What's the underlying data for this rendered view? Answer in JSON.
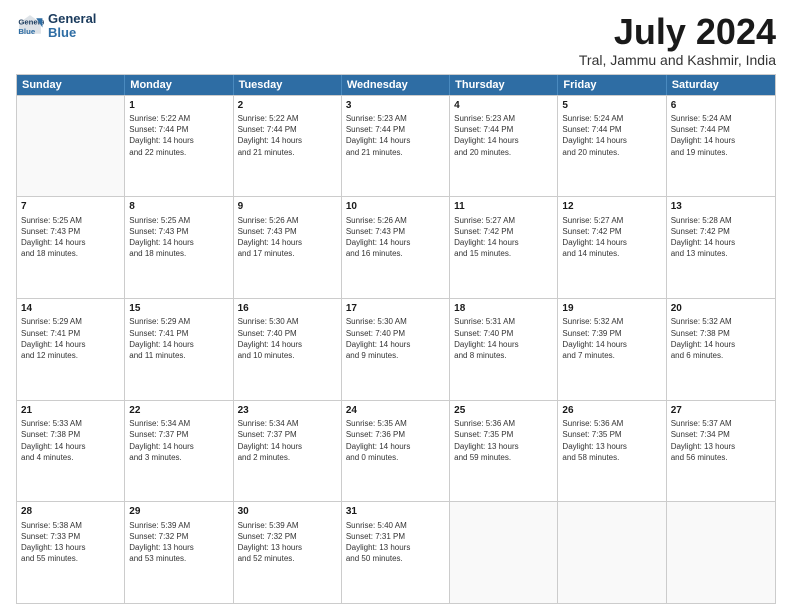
{
  "logo": {
    "line1": "General",
    "line2": "Blue"
  },
  "title": "July 2024",
  "subtitle": "Tral, Jammu and Kashmir, India",
  "weekdays": [
    "Sunday",
    "Monday",
    "Tuesday",
    "Wednesday",
    "Thursday",
    "Friday",
    "Saturday"
  ],
  "rows": [
    [
      {
        "day": "",
        "info": ""
      },
      {
        "day": "1",
        "info": "Sunrise: 5:22 AM\nSunset: 7:44 PM\nDaylight: 14 hours\nand 22 minutes."
      },
      {
        "day": "2",
        "info": "Sunrise: 5:22 AM\nSunset: 7:44 PM\nDaylight: 14 hours\nand 21 minutes."
      },
      {
        "day": "3",
        "info": "Sunrise: 5:23 AM\nSunset: 7:44 PM\nDaylight: 14 hours\nand 21 minutes."
      },
      {
        "day": "4",
        "info": "Sunrise: 5:23 AM\nSunset: 7:44 PM\nDaylight: 14 hours\nand 20 minutes."
      },
      {
        "day": "5",
        "info": "Sunrise: 5:24 AM\nSunset: 7:44 PM\nDaylight: 14 hours\nand 20 minutes."
      },
      {
        "day": "6",
        "info": "Sunrise: 5:24 AM\nSunset: 7:44 PM\nDaylight: 14 hours\nand 19 minutes."
      }
    ],
    [
      {
        "day": "7",
        "info": "Sunrise: 5:25 AM\nSunset: 7:43 PM\nDaylight: 14 hours\nand 18 minutes."
      },
      {
        "day": "8",
        "info": "Sunrise: 5:25 AM\nSunset: 7:43 PM\nDaylight: 14 hours\nand 18 minutes."
      },
      {
        "day": "9",
        "info": "Sunrise: 5:26 AM\nSunset: 7:43 PM\nDaylight: 14 hours\nand 17 minutes."
      },
      {
        "day": "10",
        "info": "Sunrise: 5:26 AM\nSunset: 7:43 PM\nDaylight: 14 hours\nand 16 minutes."
      },
      {
        "day": "11",
        "info": "Sunrise: 5:27 AM\nSunset: 7:42 PM\nDaylight: 14 hours\nand 15 minutes."
      },
      {
        "day": "12",
        "info": "Sunrise: 5:27 AM\nSunset: 7:42 PM\nDaylight: 14 hours\nand 14 minutes."
      },
      {
        "day": "13",
        "info": "Sunrise: 5:28 AM\nSunset: 7:42 PM\nDaylight: 14 hours\nand 13 minutes."
      }
    ],
    [
      {
        "day": "14",
        "info": "Sunrise: 5:29 AM\nSunset: 7:41 PM\nDaylight: 14 hours\nand 12 minutes."
      },
      {
        "day": "15",
        "info": "Sunrise: 5:29 AM\nSunset: 7:41 PM\nDaylight: 14 hours\nand 11 minutes."
      },
      {
        "day": "16",
        "info": "Sunrise: 5:30 AM\nSunset: 7:40 PM\nDaylight: 14 hours\nand 10 minutes."
      },
      {
        "day": "17",
        "info": "Sunrise: 5:30 AM\nSunset: 7:40 PM\nDaylight: 14 hours\nand 9 minutes."
      },
      {
        "day": "18",
        "info": "Sunrise: 5:31 AM\nSunset: 7:40 PM\nDaylight: 14 hours\nand 8 minutes."
      },
      {
        "day": "19",
        "info": "Sunrise: 5:32 AM\nSunset: 7:39 PM\nDaylight: 14 hours\nand 7 minutes."
      },
      {
        "day": "20",
        "info": "Sunrise: 5:32 AM\nSunset: 7:38 PM\nDaylight: 14 hours\nand 6 minutes."
      }
    ],
    [
      {
        "day": "21",
        "info": "Sunrise: 5:33 AM\nSunset: 7:38 PM\nDaylight: 14 hours\nand 4 minutes."
      },
      {
        "day": "22",
        "info": "Sunrise: 5:34 AM\nSunset: 7:37 PM\nDaylight: 14 hours\nand 3 minutes."
      },
      {
        "day": "23",
        "info": "Sunrise: 5:34 AM\nSunset: 7:37 PM\nDaylight: 14 hours\nand 2 minutes."
      },
      {
        "day": "24",
        "info": "Sunrise: 5:35 AM\nSunset: 7:36 PM\nDaylight: 14 hours\nand 0 minutes."
      },
      {
        "day": "25",
        "info": "Sunrise: 5:36 AM\nSunset: 7:35 PM\nDaylight: 13 hours\nand 59 minutes."
      },
      {
        "day": "26",
        "info": "Sunrise: 5:36 AM\nSunset: 7:35 PM\nDaylight: 13 hours\nand 58 minutes."
      },
      {
        "day": "27",
        "info": "Sunrise: 5:37 AM\nSunset: 7:34 PM\nDaylight: 13 hours\nand 56 minutes."
      }
    ],
    [
      {
        "day": "28",
        "info": "Sunrise: 5:38 AM\nSunset: 7:33 PM\nDaylight: 13 hours\nand 55 minutes."
      },
      {
        "day": "29",
        "info": "Sunrise: 5:39 AM\nSunset: 7:32 PM\nDaylight: 13 hours\nand 53 minutes."
      },
      {
        "day": "30",
        "info": "Sunrise: 5:39 AM\nSunset: 7:32 PM\nDaylight: 13 hours\nand 52 minutes."
      },
      {
        "day": "31",
        "info": "Sunrise: 5:40 AM\nSunset: 7:31 PM\nDaylight: 13 hours\nand 50 minutes."
      },
      {
        "day": "",
        "info": ""
      },
      {
        "day": "",
        "info": ""
      },
      {
        "day": "",
        "info": ""
      }
    ]
  ]
}
